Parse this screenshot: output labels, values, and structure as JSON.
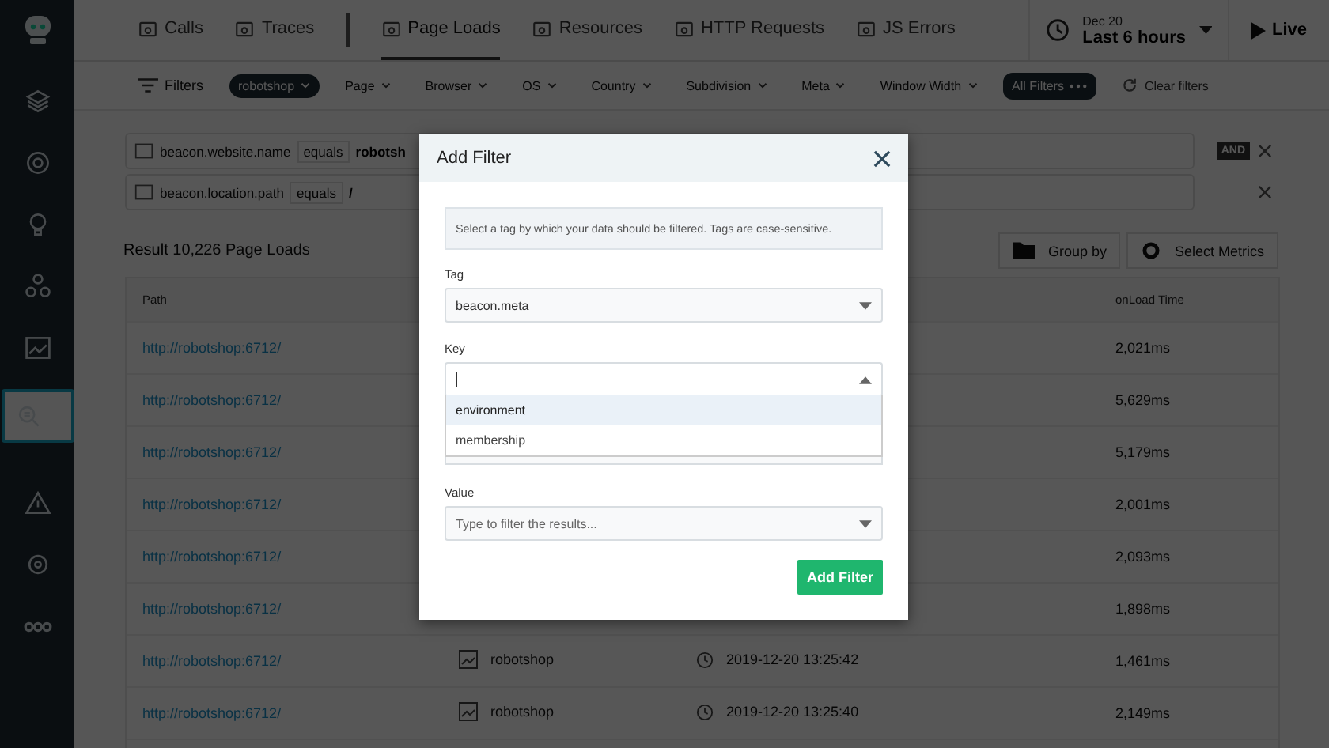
{
  "sidebar": {
    "items": [
      {
        "selected": false
      },
      {
        "selected": false
      },
      {
        "selected": false
      },
      {
        "selected": false
      },
      {
        "selected": false
      },
      {
        "selected": true
      },
      {
        "selected": false
      },
      {
        "selected": false
      },
      {
        "selected": false
      }
    ]
  },
  "top_nav": {
    "tabs": [
      {
        "label": "Calls",
        "selected": false
      },
      {
        "label": "Traces",
        "selected": false
      },
      {
        "label": "Page Loads",
        "selected": true
      },
      {
        "label": "Resources",
        "selected": false
      },
      {
        "label": "HTTP Requests",
        "selected": false
      },
      {
        "label": "JS Errors",
        "selected": false
      }
    ],
    "time_range": {
      "date": "Dec 20",
      "label": "Last 6 hours"
    },
    "live": "Live"
  },
  "filter_bar": {
    "label": "Filters",
    "chips": [
      {
        "label": "robotshop",
        "selected": true
      },
      {
        "label": "Page",
        "selected": false
      },
      {
        "label": "Browser",
        "selected": false
      },
      {
        "label": "OS",
        "selected": false
      },
      {
        "label": "Country",
        "selected": false
      },
      {
        "label": "Subdivision",
        "selected": false
      },
      {
        "label": "Meta",
        "selected": false
      },
      {
        "label": "Window Width",
        "selected": false
      }
    ],
    "all_filters": "All Filters",
    "clear": "Clear filters"
  },
  "filters": [
    {
      "tag": "beacon.website.name",
      "operator": "equals",
      "value": "robotsh"
    },
    {
      "tag": "beacon.location.path",
      "operator": "equals",
      "value": "/"
    }
  ],
  "filter_join": "AND",
  "result": {
    "label": "Result",
    "count": "10,226 Page Loads",
    "group_by": "Group by",
    "select_metrics": "Select Metrics"
  },
  "table": {
    "columns": [
      "Path",
      "onLoad Time"
    ],
    "rows": [
      {
        "path": "http://robotshop:6712/",
        "onload_time": "2,021ms"
      },
      {
        "path": "http://robotshop:6712/",
        "onload_time": "5,629ms"
      },
      {
        "path": "http://robotshop:6712/",
        "onload_time": "5,179ms"
      },
      {
        "path": "http://robotshop:6712/",
        "onload_time": "2,001ms"
      },
      {
        "path": "http://robotshop:6712/",
        "onload_time": "2,093ms"
      },
      {
        "path": "http://robotshop:6712/",
        "onload_time": "1,898ms"
      },
      {
        "path": "http://robotshop:6712/",
        "website": "robotshop",
        "timestamp": "2019-12-20 13:25:42",
        "onload_time": "1,461ms"
      },
      {
        "path": "http://robotshop:6712/",
        "website": "robotshop",
        "timestamp": "2019-12-20 13:25:40",
        "onload_time": "2,149ms"
      }
    ]
  },
  "dialog": {
    "title": "Add Filter",
    "hint": "Select a tag by which your data should be filtered. Tags are case-sensitive.",
    "tag": {
      "label": "Tag",
      "value": "beacon.meta"
    },
    "key": {
      "label": "Key",
      "expanded": true,
      "options": [
        {
          "label": "environment",
          "selected": true
        },
        {
          "label": "membership",
          "selected": false
        }
      ]
    },
    "value": {
      "label": "Value",
      "placeholder": "Type to filter the results..."
    },
    "submit": "Add Filter"
  }
}
